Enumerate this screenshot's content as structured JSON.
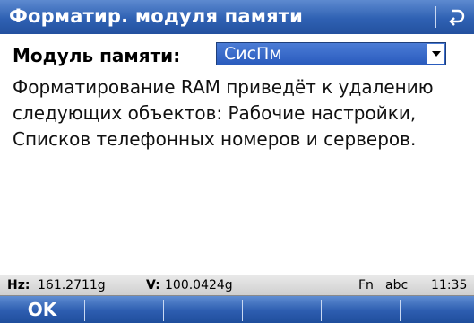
{
  "titlebar": {
    "title": "Форматир. модуля памяти",
    "back_icon": "return-arrow-icon"
  },
  "form": {
    "field_label": "Модуль памяти:",
    "dropdown_value": "СисПм"
  },
  "message": {
    "lines": [
      "Форматирование RAM приведёт к удалению",
      "следующих объектов: Рабочие настройки,",
      "Списков телефонных номеров и серверов."
    ]
  },
  "statusbar": {
    "hz_label": "Hz:",
    "hz_value": "161.2711g",
    "v_label": "V:",
    "v_value": "100.0424g",
    "fn": "Fn",
    "mode": "abc",
    "time": "11:35"
  },
  "softkeys": {
    "f1": "OK",
    "f2": "",
    "f3": "",
    "f4": "",
    "f5": "",
    "f6": ""
  },
  "colors": {
    "title_bar": "#2f61b3",
    "dropdown": "#2a5bbd",
    "status_bar": "#dcdcdc"
  }
}
